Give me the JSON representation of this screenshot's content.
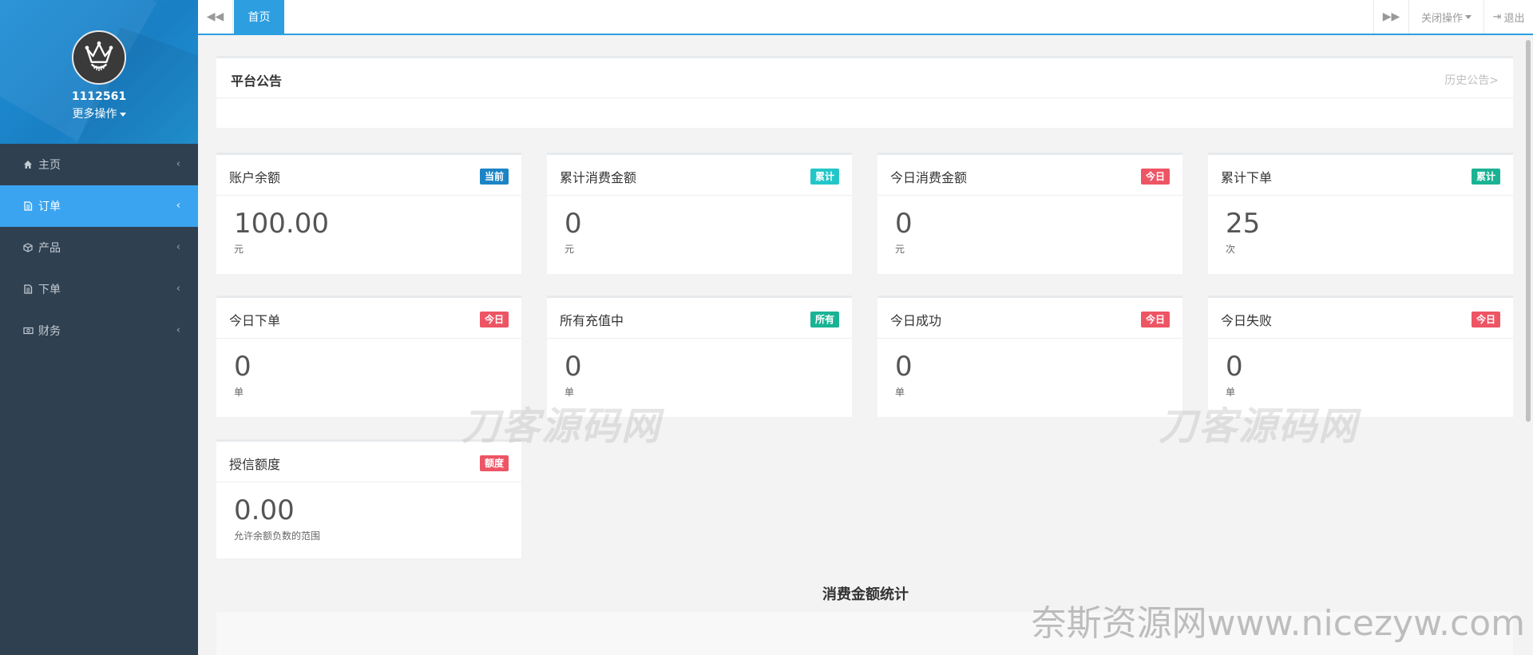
{
  "sidebar": {
    "username": "1112561",
    "more_ops": "更多操作",
    "items": [
      {
        "label": "主页",
        "icon": "home-icon"
      },
      {
        "label": "订单",
        "icon": "file-icon"
      },
      {
        "label": "产品",
        "icon": "cube-icon"
      },
      {
        "label": "下单",
        "icon": "file-icon"
      },
      {
        "label": "财务",
        "icon": "money-icon"
      }
    ]
  },
  "topbar": {
    "tab_home": "首页",
    "close_ops": "关闭操作",
    "logout": "退出"
  },
  "notice": {
    "title": "平台公告",
    "history_link": "历史公告>"
  },
  "cards": [
    {
      "title": "账户余额",
      "badge": "当前",
      "badge_color": "#1c84c6",
      "value": "100.00",
      "unit": "元"
    },
    {
      "title": "累计消费金额",
      "badge": "累计",
      "badge_color": "#23c6c8",
      "value": "0",
      "unit": "元"
    },
    {
      "title": "今日消费金额",
      "badge": "今日",
      "badge_color": "#ed5565",
      "value": "0",
      "unit": "元"
    },
    {
      "title": "累计下单",
      "badge": "累计",
      "badge_color": "#1ab394",
      "value": "25",
      "unit": "次"
    },
    {
      "title": "今日下单",
      "badge": "今日",
      "badge_color": "#ed5565",
      "value": "0",
      "unit": "单"
    },
    {
      "title": "所有充值中",
      "badge": "所有",
      "badge_color": "#1ab394",
      "value": "0",
      "unit": "单"
    },
    {
      "title": "今日成功",
      "badge": "今日",
      "badge_color": "#ed5565",
      "value": "0",
      "unit": "单"
    },
    {
      "title": "今日失败",
      "badge": "今日",
      "badge_color": "#ed5565",
      "value": "0",
      "unit": "单"
    },
    {
      "title": "授信额度",
      "badge": "额度",
      "badge_color": "#ed5565",
      "value": "0.00",
      "unit": "允许余额负数的范围"
    }
  ],
  "stats_title": "消费金额统计",
  "watermarks": {
    "left": "刀客源码网",
    "right": "刀客源码网",
    "bottom": "奈斯资源网www.nicezyw.com"
  }
}
